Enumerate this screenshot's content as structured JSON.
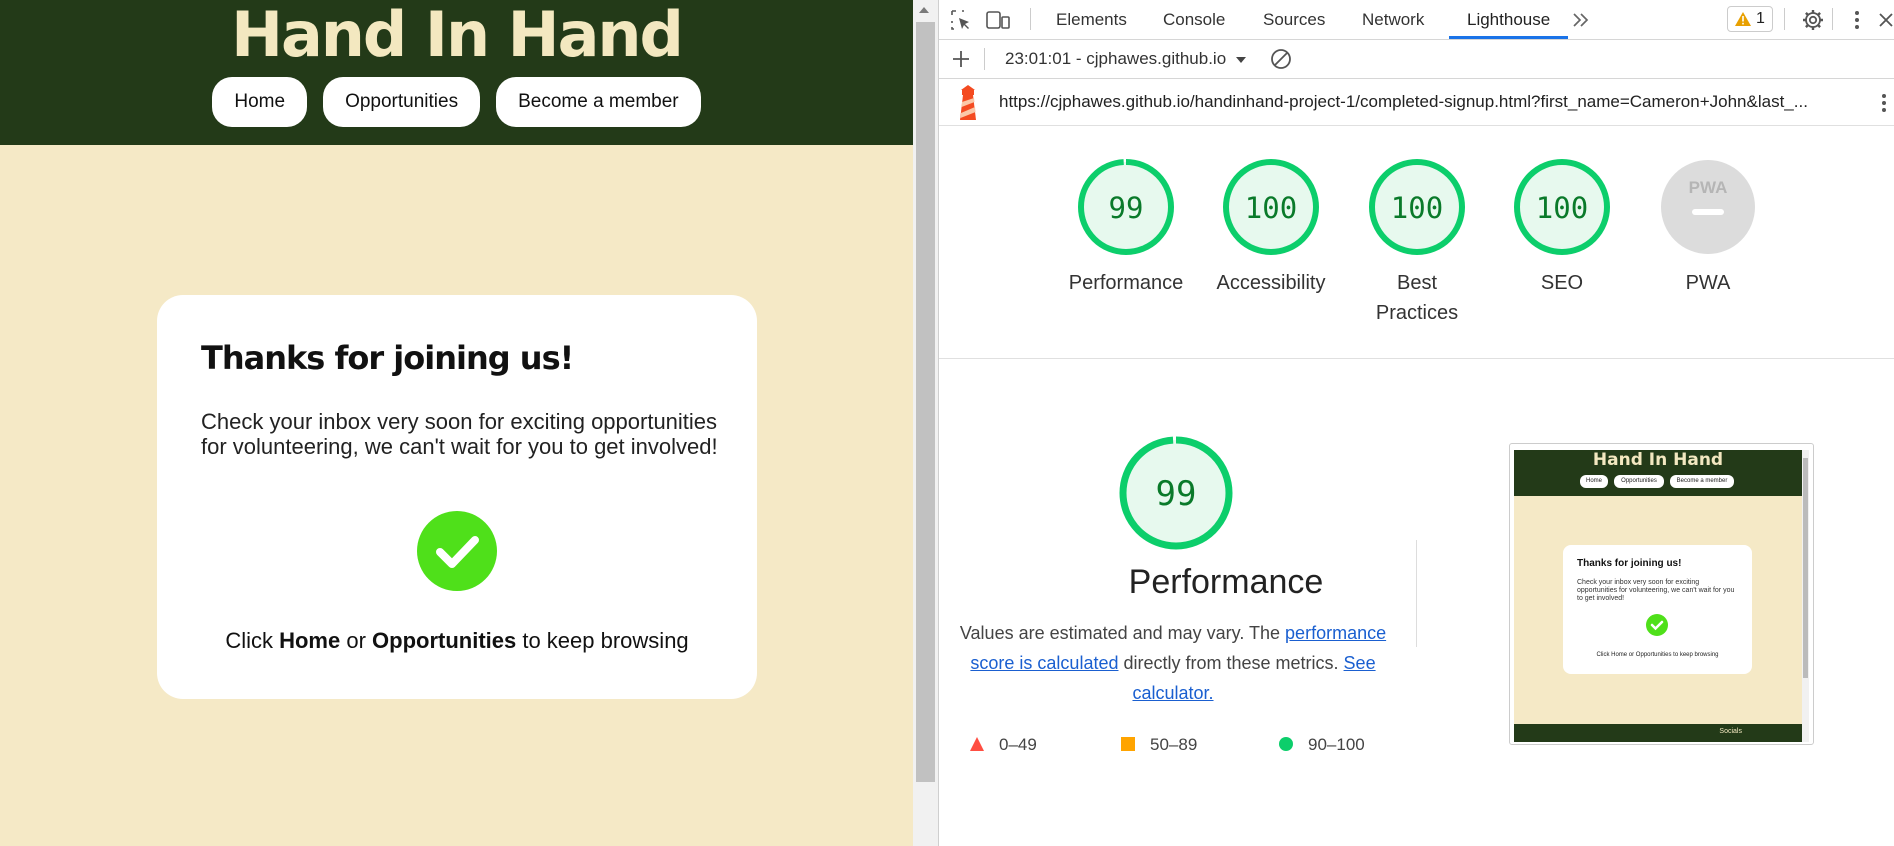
{
  "site": {
    "title": "Hand In Hand",
    "nav": [
      "Home",
      "Opportunities",
      "Become a member"
    ],
    "card": {
      "title": "Thanks for joining us!",
      "text": "Check your inbox very soon for exciting opportunities for volunteering, we can't wait for you to get involved!",
      "foot_pre": "Click ",
      "foot_home": "Home",
      "foot_mid": " or ",
      "foot_opps": "Opportunities",
      "foot_post": " to keep browsing"
    },
    "colors": {
      "header": "#233a18",
      "background": "#f5e9c6",
      "check": "#4fe01a"
    }
  },
  "devtools": {
    "tabs": [
      "Elements",
      "Console",
      "Sources",
      "Network",
      "Lighthouse"
    ],
    "active_tab": "Lighthouse",
    "warning_count": "1",
    "report_selector": "23:01:01 - cjphawes.github.io",
    "url": "https://cjphawes.github.io/handinhand-project-1/completed-signup.html?first_name=Cameron+John&last_...",
    "scores": [
      {
        "label": "Performance",
        "value": "99",
        "fraction": 0.99
      },
      {
        "label": "Accessibility",
        "value": "100",
        "fraction": 1.0
      },
      {
        "label": "Best Practices",
        "value": "100",
        "fraction": 1.0
      },
      {
        "label": "SEO",
        "value": "100",
        "fraction": 1.0
      },
      {
        "label": "PWA",
        "value": "PWA",
        "fraction": 0
      }
    ],
    "performance": {
      "score": "99",
      "title": "Performance",
      "desc_pre": "Values are estimated and may vary. The ",
      "desc_link1": "performance score is calculated",
      "desc_mid": " directly from these metrics. ",
      "desc_link2": "See calculator."
    },
    "legend": [
      "0–49",
      "50–89",
      "90–100"
    ],
    "thumbnail": {
      "title": "Hand In Hand",
      "nav": [
        "Home",
        "Opportunities",
        "Become a member"
      ],
      "card_title": "Thanks for joining us!",
      "card_text": "Check your inbox very soon for exciting opportunities for volunteering, we can't wait for you to get involved!",
      "card_foot": "Click Home or Opportunities to keep browsing",
      "footer": "Socials"
    },
    "colors": {
      "pass": "#0cce6b",
      "average": "#ffa400",
      "fail": "#ff4e42",
      "accent": "#1a73e8"
    }
  }
}
